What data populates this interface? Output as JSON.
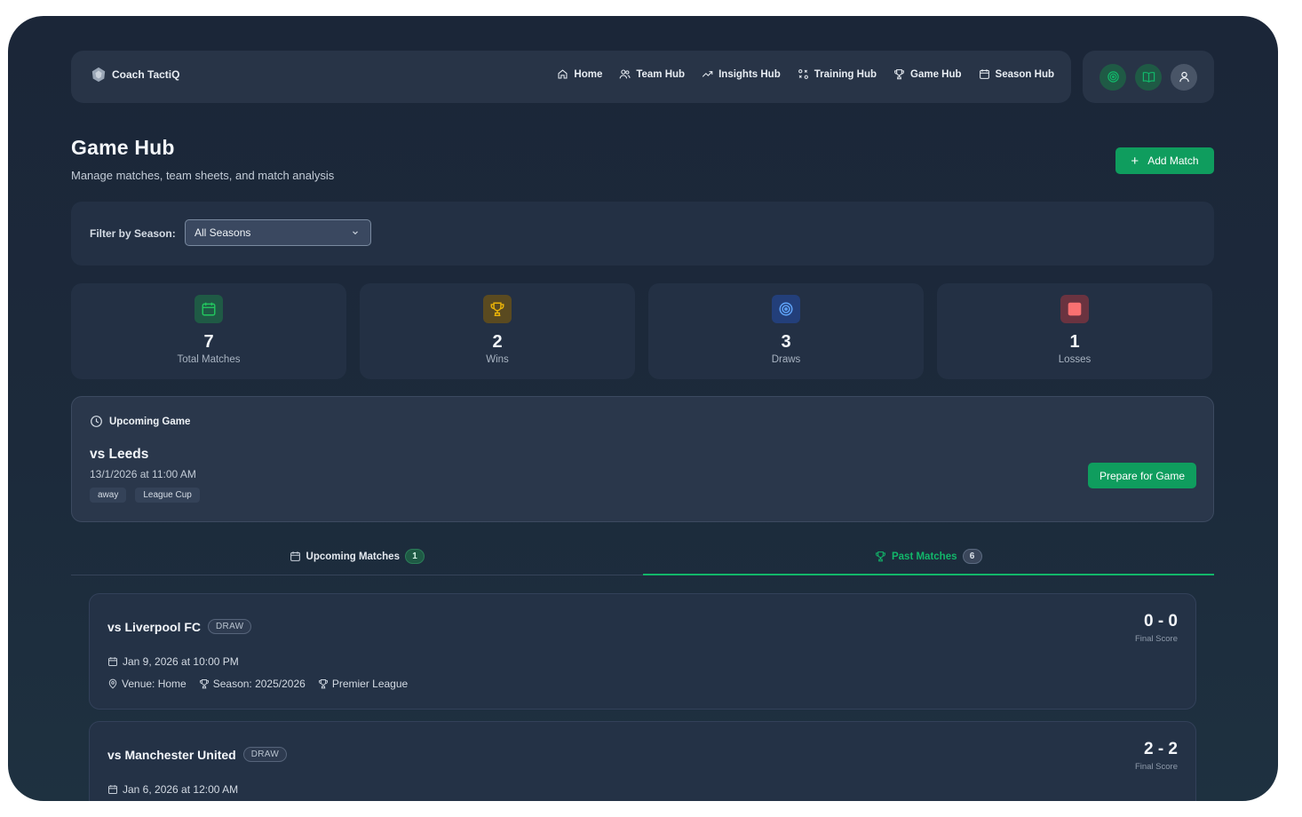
{
  "brand": {
    "name": "Coach TactiQ"
  },
  "nav": {
    "items": [
      {
        "label": "Home",
        "icon": "home-icon"
      },
      {
        "label": "Team Hub",
        "icon": "users-icon"
      },
      {
        "label": "Insights Hub",
        "icon": "trending-icon"
      },
      {
        "label": "Training Hub",
        "icon": "tactics-icon"
      },
      {
        "label": "Game Hub",
        "icon": "trophy-icon"
      },
      {
        "label": "Season Hub",
        "icon": "calendar-icon"
      }
    ]
  },
  "header": {
    "title": "Game Hub",
    "subtitle": "Manage matches, team sheets, and match analysis",
    "add_button": "Add Match"
  },
  "filter": {
    "label": "Filter by Season:",
    "selected": "All Seasons"
  },
  "stats": [
    {
      "value": "7",
      "label": "Total Matches",
      "icon": "calendar-icon",
      "color": "#22c55e"
    },
    {
      "value": "2",
      "label": "Wins",
      "icon": "trophy-icon",
      "color": "#eab308"
    },
    {
      "value": "3",
      "label": "Draws",
      "icon": "target-icon",
      "color": "#3b82f6"
    },
    {
      "value": "1",
      "label": "Losses",
      "icon": "square-icon",
      "color": "#f87171"
    }
  ],
  "upcoming": {
    "heading": "Upcoming Game",
    "opponent": "vs Leeds",
    "datetime": "13/1/2026 at 11:00 AM",
    "tags": [
      "away",
      "League Cup"
    ],
    "button": "Prepare for Game"
  },
  "tabs": [
    {
      "label": "Upcoming Matches",
      "count": "1"
    },
    {
      "label": "Past Matches",
      "count": "6"
    }
  ],
  "matches": [
    {
      "opponent": "vs Liverpool FC",
      "result": "DRAW",
      "date": "Jan 9, 2026 at 10:00 PM",
      "venue": "Venue: Home",
      "season": "Season: 2025/2026",
      "competition": "Premier League",
      "score": "0 - 0",
      "score_label": "Final Score"
    },
    {
      "opponent": "vs Manchester United",
      "result": "DRAW",
      "date": "Jan 6, 2026 at 12:00 AM",
      "score": "2 - 2",
      "score_label": "Final Score"
    }
  ],
  "colors": {
    "accent": "#0f9d5e",
    "active_tab": "#12b76a"
  }
}
